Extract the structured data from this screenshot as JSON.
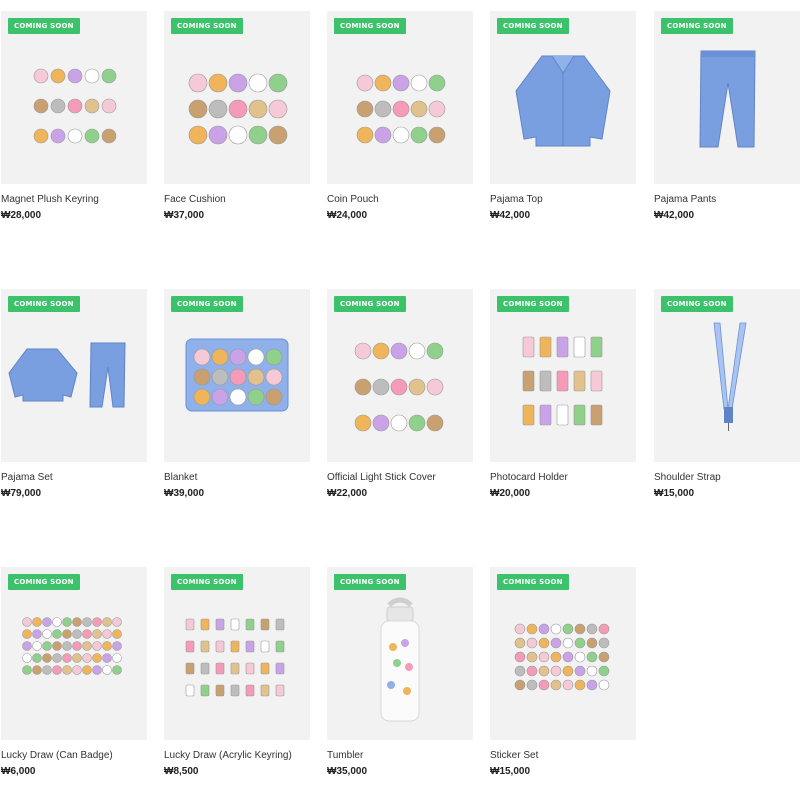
{
  "products": [
    {
      "name": "Magnet Plush Keyring",
      "price": "₩28,000",
      "badge": "COMING SOON",
      "icon": "plush-keyring-image"
    },
    {
      "name": "Face Cushion",
      "price": "₩37,000",
      "badge": "COMING SOON",
      "icon": "face-cushion-image"
    },
    {
      "name": "Coin Pouch",
      "price": "₩24,000",
      "badge": "COMING SOON",
      "icon": "coin-pouch-image"
    },
    {
      "name": "Pajama Top",
      "price": "₩42,000",
      "badge": "COMING SOON",
      "icon": "pajama-top-image"
    },
    {
      "name": "Pajama Pants",
      "price": "₩42,000",
      "badge": "COMING SOON",
      "icon": "pajama-pants-image"
    },
    {
      "name": "Pajama Set",
      "price": "₩79,000",
      "badge": "COMING SOON",
      "icon": "pajama-set-image"
    },
    {
      "name": "Blanket",
      "price": "₩39,000",
      "badge": "COMING SOON",
      "icon": "blanket-image"
    },
    {
      "name": "Official Light Stick Cover",
      "price": "₩22,000",
      "badge": "COMING SOON",
      "icon": "light-stick-cover-image"
    },
    {
      "name": "Photocard Holder",
      "price": "₩20,000",
      "badge": "COMING SOON",
      "icon": "photocard-holder-image"
    },
    {
      "name": "Shoulder Strap",
      "price": "₩15,000",
      "badge": "COMING SOON",
      "icon": "shoulder-strap-image"
    },
    {
      "name": "Lucky Draw (Can Badge)",
      "price": "₩6,000",
      "badge": "COMING SOON",
      "icon": "can-badge-image"
    },
    {
      "name": "Lucky Draw (Acrylic Keyring)",
      "price": "₩8,500",
      "badge": "COMING SOON",
      "icon": "acrylic-keyring-image"
    },
    {
      "name": "Tumbler",
      "price": "₩35,000",
      "badge": "COMING SOON",
      "icon": "tumbler-image"
    },
    {
      "name": "Sticker Set",
      "price": "₩15,000",
      "badge": "COMING SOON",
      "icon": "sticker-set-image"
    }
  ],
  "colors": {
    "badge": "#3cc26b",
    "thumb_bg": "#f2f2f2",
    "pajama_blue": "#7a9fe0"
  }
}
